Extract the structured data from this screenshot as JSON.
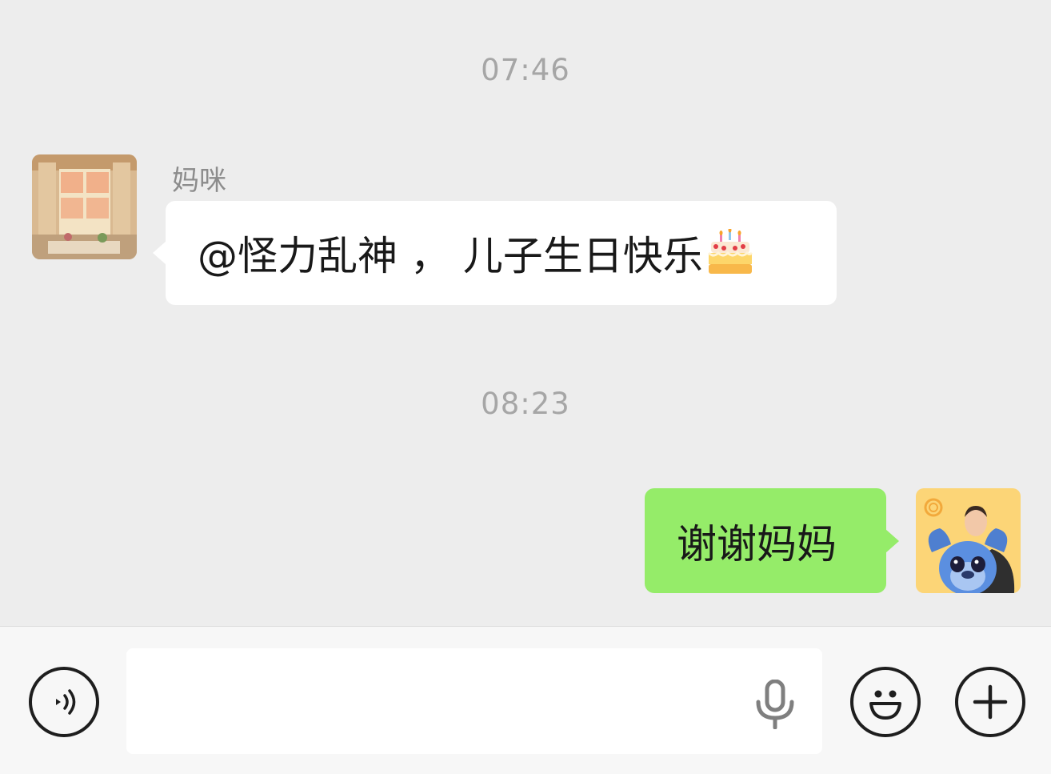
{
  "messages": [
    {
      "timestamp": "07:46",
      "sender": "妈咪",
      "direction": "incoming",
      "text": "@怪力乱神 ， 儿子生日快乐",
      "emoji": "birthday-cake-icon"
    },
    {
      "timestamp": "08:23",
      "direction": "outgoing",
      "text": "谢谢妈妈"
    }
  ],
  "input": {
    "value": "",
    "placeholder": ""
  },
  "colors": {
    "background": "#ededed",
    "incoming_bubble": "#ffffff",
    "outgoing_bubble": "#95ec69",
    "timestamp": "#a6a6a6",
    "input_bar": "#f7f7f7"
  },
  "icons": [
    "voice-icon",
    "microphone-icon",
    "emoji-icon",
    "plus-icon"
  ]
}
